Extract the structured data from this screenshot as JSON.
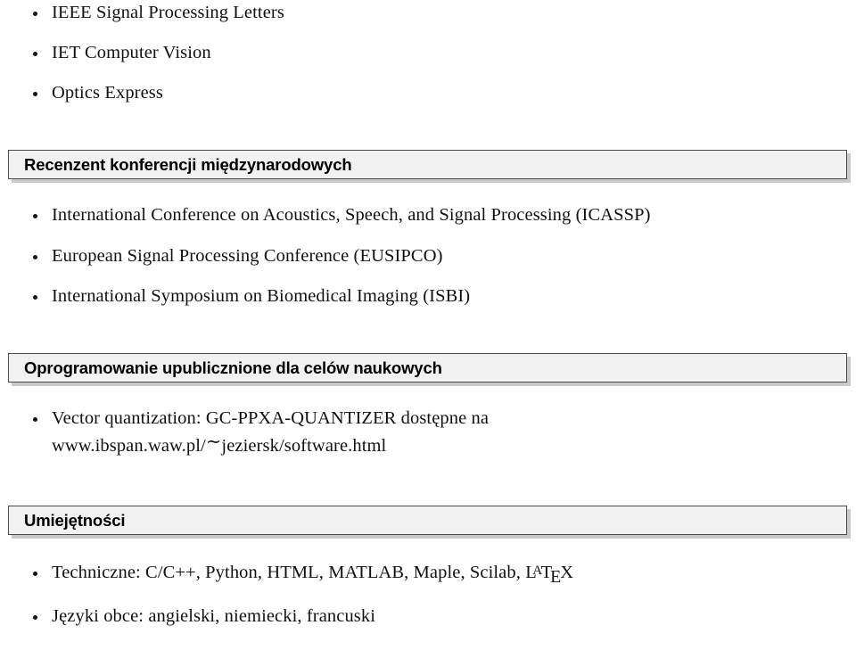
{
  "document": {
    "language": "pl",
    "type": "cv-fragment"
  },
  "journals": {
    "items": [
      "IEEE Signal Processing Letters",
      "IET Computer Vision",
      "Optics Express"
    ]
  },
  "sections": [
    {
      "id": "reviewer",
      "title": "Recenzent konferencji międzynarodowych"
    },
    {
      "id": "software",
      "title": "Oprogramowanie upublicznione dla celów naukowych"
    },
    {
      "id": "skills",
      "title": "Umiejętności"
    }
  ],
  "conferences": {
    "items": [
      "International Conference on Acoustics, Speech, and Signal Processing (ICASSP)",
      "European Signal Processing Conference (EUSIPCO)",
      "International Symposium on Biomedical Imaging (ISBI)"
    ]
  },
  "software": {
    "items": [
      {
        "line1": "Vector quantization: GC-PPXA-QUANTIZER dostępne na",
        "url_prefix": "www.ibspan.waw.pl/",
        "url_tilde": "∼",
        "url_suffix": "jeziersk/software.html"
      }
    ]
  },
  "skills": {
    "items": [
      {
        "prefix": "Techniczne: C/C++, Python, HTML, MATLAB, Maple, Scilab, ",
        "latex": {
          "l": "L",
          "a": "A",
          "t": "T",
          "e": "E",
          "x": "X"
        },
        "suffix": ""
      },
      {
        "prefix": "Języki obce: angielski, niemiecki, francuski",
        "latex": null,
        "suffix": ""
      }
    ]
  },
  "style": {
    "page_background": "#ffffff",
    "bar_background": "#f1f1f1",
    "bar_border": "#4a4a4a",
    "bar_shadow": "#c9c9c9",
    "text_color": "#101010"
  }
}
